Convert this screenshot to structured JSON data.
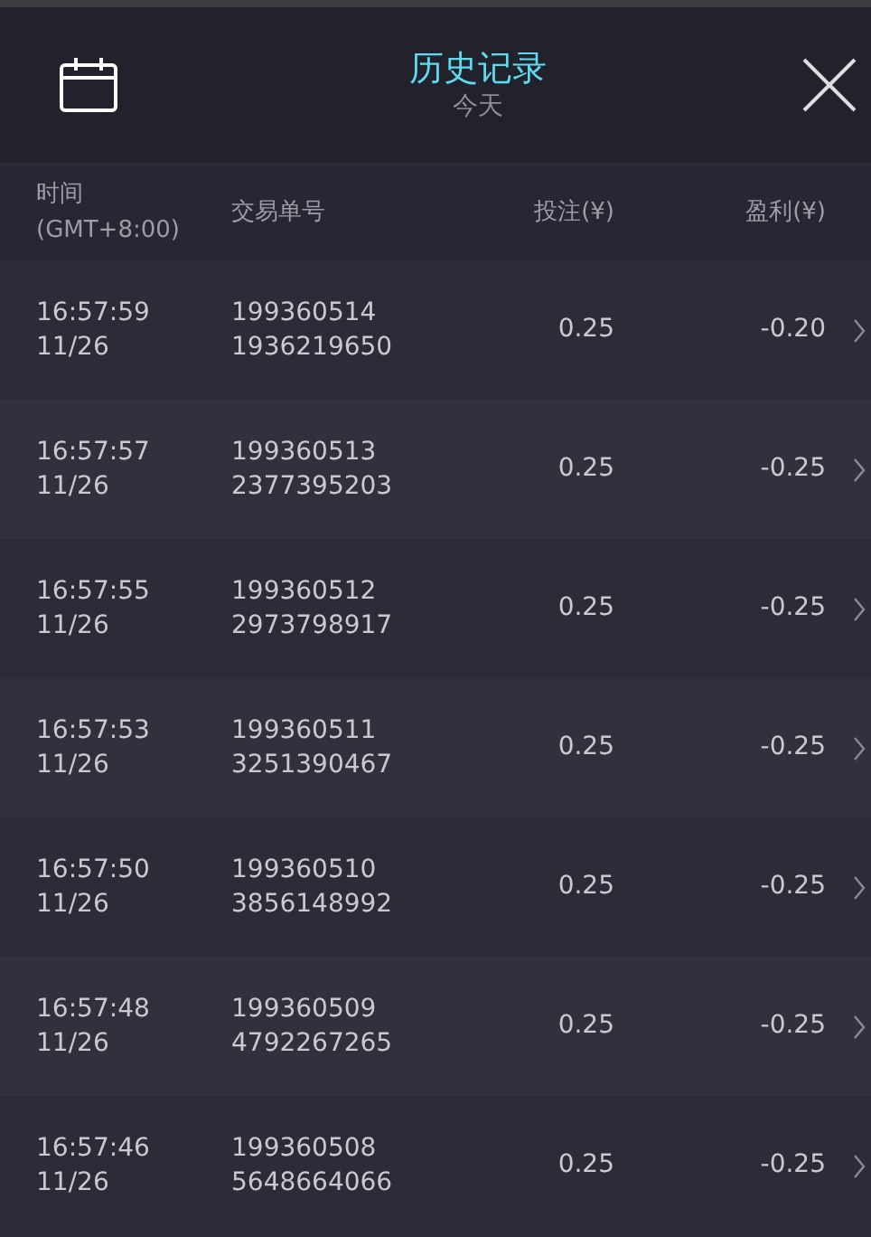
{
  "header": {
    "title": "历史记录",
    "subtitle": "今天"
  },
  "table": {
    "columns": [
      "时间\n(GMT+8:00)",
      "交易单号",
      "投注(¥)",
      "盈利(¥)"
    ],
    "rows": [
      {
        "time": "16:57:59",
        "date": "11/26",
        "id": "199360514",
        "ref": "1936219650",
        "stake": "0.25",
        "profit": "-0.20"
      },
      {
        "time": "16:57:57",
        "date": "11/26",
        "id": "199360513",
        "ref": "2377395203",
        "stake": "0.25",
        "profit": "-0.25"
      },
      {
        "time": "16:57:55",
        "date": "11/26",
        "id": "199360512",
        "ref": "2973798917",
        "stake": "0.25",
        "profit": "-0.25"
      },
      {
        "time": "16:57:53",
        "date": "11/26",
        "id": "199360511",
        "ref": "3251390467",
        "stake": "0.25",
        "profit": "-0.25"
      },
      {
        "time": "16:57:50",
        "date": "11/26",
        "id": "199360510",
        "ref": "3856148992",
        "stake": "0.25",
        "profit": "-0.25"
      },
      {
        "time": "16:57:48",
        "date": "11/26",
        "id": "199360509",
        "ref": "4792267265",
        "stake": "0.25",
        "profit": "-0.25"
      },
      {
        "time": "16:57:46",
        "date": "11/26",
        "id": "199360508",
        "ref": "5648664066",
        "stake": "0.25",
        "profit": "-0.25"
      }
    ]
  }
}
